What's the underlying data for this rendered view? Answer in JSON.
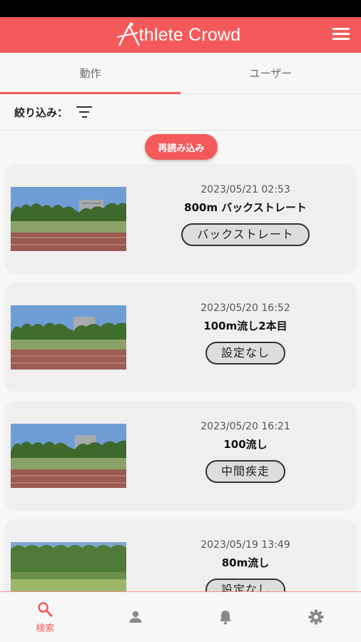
{
  "header": {
    "logo_text": "thlete Crowd",
    "logo_letter": "A"
  },
  "tabs": [
    {
      "label": "動作",
      "active": true
    },
    {
      "label": "ユーザー",
      "active": false
    }
  ],
  "filter": {
    "label": "絞り込み："
  },
  "reload_label": "再読み込み",
  "cards": [
    {
      "date": "2023/05/21 02:53",
      "title": "800m バックストレート",
      "tag": "バックストレート"
    },
    {
      "date": "2023/05/20 16:52",
      "title": "100m流し2本目",
      "tag": "設定なし"
    },
    {
      "date": "2023/05/20 16:21",
      "title": "100流し",
      "tag": "中間疾走"
    },
    {
      "date": "2023/05/19 13:49",
      "title": "80m流し",
      "tag": "設定なし"
    }
  ],
  "bottom_nav": [
    {
      "icon": "search-icon",
      "label": "検索",
      "active": true
    },
    {
      "icon": "user-icon",
      "label": "",
      "active": false
    },
    {
      "icon": "bell-icon",
      "label": "",
      "active": false
    },
    {
      "icon": "gear-icon",
      "label": "",
      "active": false
    }
  ],
  "colors": {
    "accent": "#f55a5a",
    "background": "#f7f7f7",
    "card": "#efefef"
  }
}
